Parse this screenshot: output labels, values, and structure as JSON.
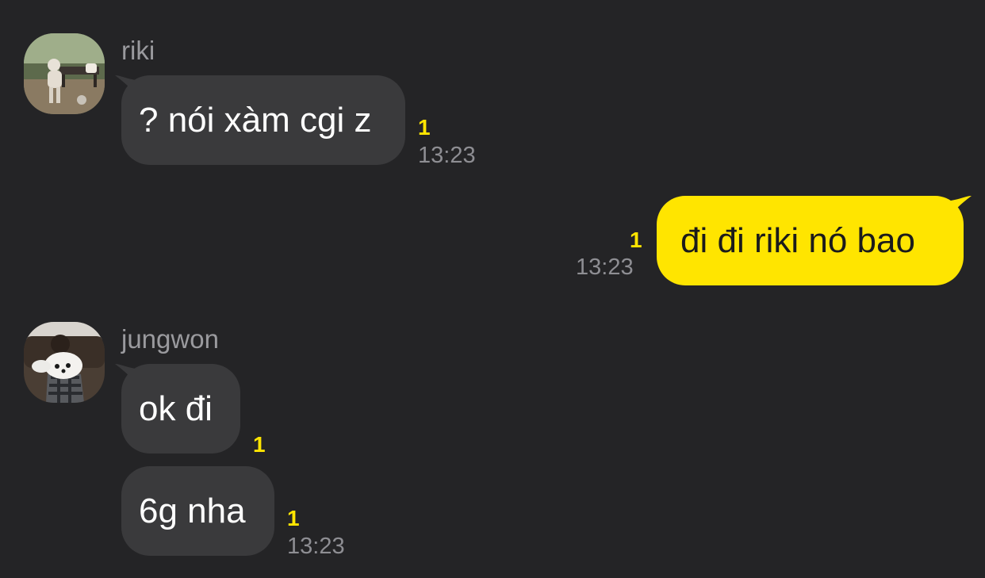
{
  "colors": {
    "background": "#242426",
    "incoming_bubble": "#3a3a3c",
    "outgoing_bubble": "#ffe500",
    "unread_count": "#ffe500",
    "sender_name": "#9a9a9e",
    "timestamp": "#8e8e93"
  },
  "messages": [
    {
      "sender": "riki",
      "direction": "incoming",
      "avatar": "riki-avatar-photo",
      "text": "? nói xàm cgi z",
      "unread": "1",
      "time": "13:23"
    },
    {
      "direction": "outgoing",
      "text": "đi đi riki nó bao",
      "unread": "1",
      "time": "13:23"
    },
    {
      "sender": "jungwon",
      "direction": "incoming",
      "avatar": "jungwon-avatar-photo",
      "text": "ok đi",
      "unread": "1"
    },
    {
      "sender": "jungwon",
      "direction": "incoming",
      "text": "6g nha",
      "unread": "1",
      "time": "13:23"
    }
  ]
}
